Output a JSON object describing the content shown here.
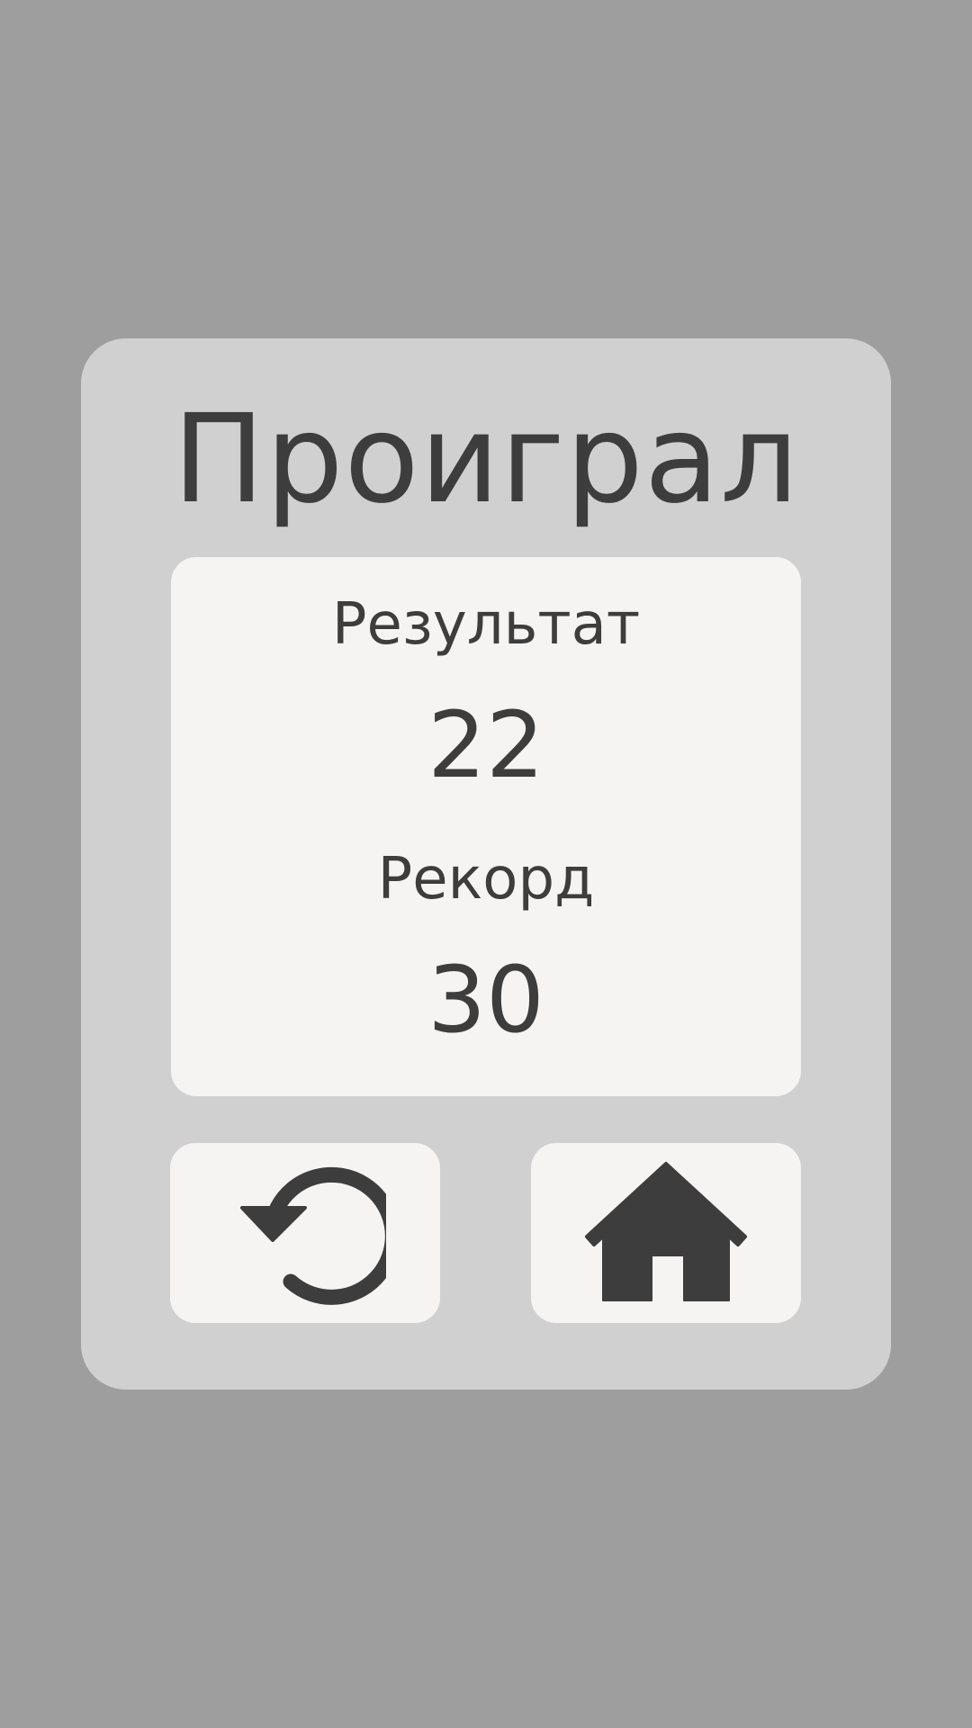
{
  "dialog": {
    "title": "Проиграл"
  },
  "stats": {
    "result_label": "Результат",
    "result_value": "22",
    "record_label": "Рекорд",
    "record_value": "30"
  },
  "buttons": {
    "restart_icon": "restart-icon",
    "home_icon": "home-icon"
  },
  "colors": {
    "background": "#9e9e9e",
    "dialog": "#d0d0d0",
    "panel": "#f6f3f3",
    "text": "#3d3d3d"
  }
}
